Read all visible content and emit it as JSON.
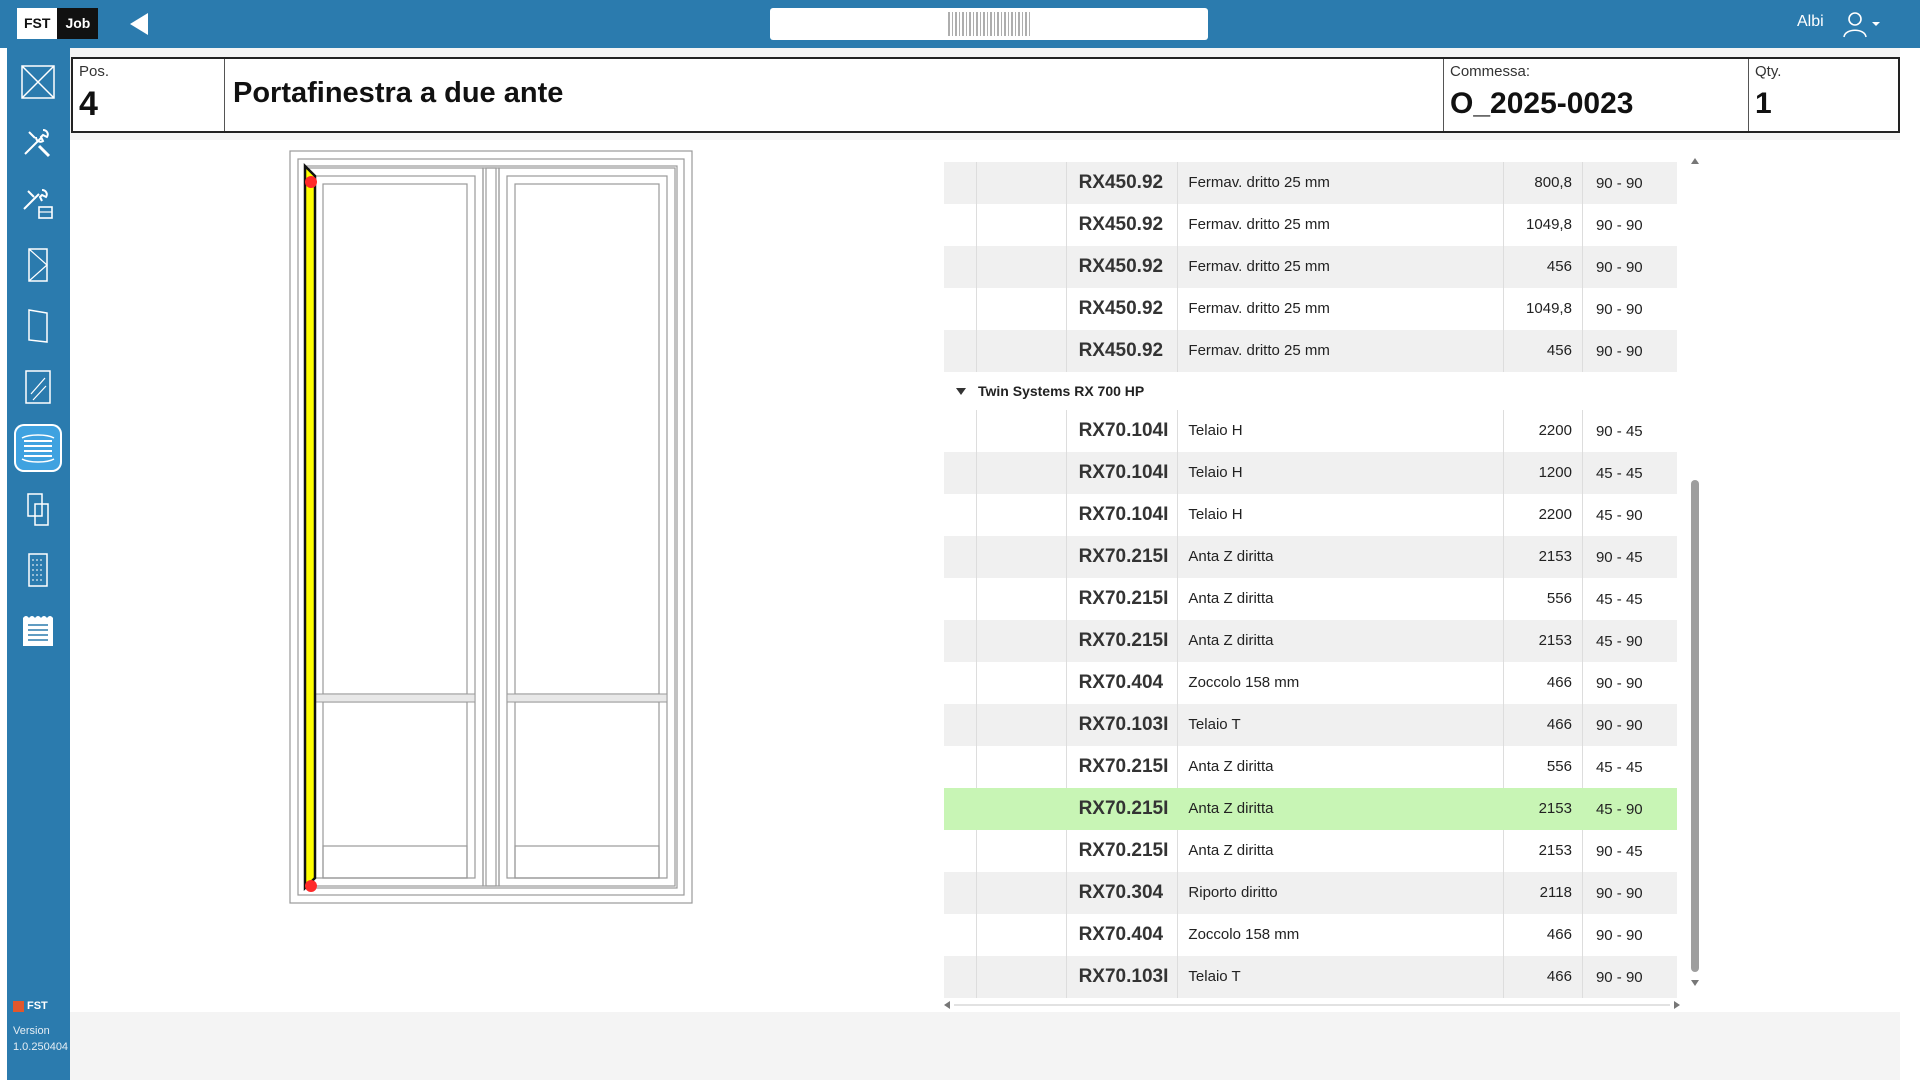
{
  "app": {
    "logo_left": "FST",
    "logo_right": "Job",
    "user": "Albi"
  },
  "search": {
    "placeholder": ""
  },
  "sidebar": {
    "brand": "FST",
    "version_label": "Version",
    "version": "1.0.250404",
    "items": [
      {
        "icon": "frame-cross-icon"
      },
      {
        "icon": "tools-icon"
      },
      {
        "icon": "tools-box-icon"
      },
      {
        "icon": "door-profile-icon"
      },
      {
        "icon": "sash-panel-icon"
      },
      {
        "icon": "glass-pane-icon"
      },
      {
        "icon": "profile-list-icon",
        "active": true
      },
      {
        "icon": "components-icon"
      },
      {
        "icon": "cut-list-icon"
      },
      {
        "icon": "report-list-icon"
      }
    ]
  },
  "header": {
    "pos_label": "Pos.",
    "pos_value": "4",
    "title": "Portafinestra a due ante",
    "order_label": "Commessa:",
    "order_value": "O_2025-0023",
    "qty_label": "Qty.",
    "qty_value": "1"
  },
  "table": {
    "rows_top": [
      {
        "code": "RX450.92",
        "desc": "Fermav. dritto 25 mm",
        "length": "800,8",
        "angles": "90 - 90"
      },
      {
        "code": "RX450.92",
        "desc": "Fermav. dritto 25 mm",
        "length": "1049,8",
        "angles": "90 - 90"
      },
      {
        "code": "RX450.92",
        "desc": "Fermav. dritto 25 mm",
        "length": "456",
        "angles": "90 - 90"
      },
      {
        "code": "RX450.92",
        "desc": "Fermav. dritto 25 mm",
        "length": "1049,8",
        "angles": "90 - 90"
      },
      {
        "code": "RX450.92",
        "desc": "Fermav. dritto 25 mm",
        "length": "456",
        "angles": "90 - 90"
      }
    ],
    "group": "Twin Systems RX 700 HP",
    "rows_group": [
      {
        "code": "RX70.104I",
        "desc": "Telaio H",
        "length": "2200",
        "angles": "90 - 45"
      },
      {
        "code": "RX70.104I",
        "desc": "Telaio H",
        "length": "1200",
        "angles": "45 - 45"
      },
      {
        "code": "RX70.104I",
        "desc": "Telaio H",
        "length": "2200",
        "angles": "45 - 90"
      },
      {
        "code": "RX70.215I",
        "desc": "Anta Z diritta",
        "length": "2153",
        "angles": "90 - 45"
      },
      {
        "code": "RX70.215I",
        "desc": "Anta Z diritta",
        "length": "556",
        "angles": "45 - 45"
      },
      {
        "code": "RX70.215I",
        "desc": "Anta Z diritta",
        "length": "2153",
        "angles": "45 - 90"
      },
      {
        "code": "RX70.404",
        "desc": "Zoccolo 158 mm",
        "length": "466",
        "angles": "90 - 90"
      },
      {
        "code": "RX70.103I",
        "desc": "Telaio T",
        "length": "466",
        "angles": "90 - 90"
      },
      {
        "code": "RX70.215I",
        "desc": "Anta Z diritta",
        "length": "556",
        "angles": "45 - 45"
      },
      {
        "code": "RX70.215I",
        "desc": "Anta Z diritta",
        "length": "2153",
        "angles": "45 - 90",
        "selected": true
      },
      {
        "code": "RX70.215I",
        "desc": "Anta Z diritta",
        "length": "2153",
        "angles": "90 - 45"
      },
      {
        "code": "RX70.304",
        "desc": "Riporto diritto",
        "length": "2118",
        "angles": "90 - 90"
      },
      {
        "code": "RX70.404",
        "desc": "Zoccolo 158 mm",
        "length": "466",
        "angles": "90 - 90"
      },
      {
        "code": "RX70.103I",
        "desc": "Telaio T",
        "length": "466",
        "angles": "90 - 90"
      }
    ]
  },
  "colors": {
    "brand": "#2b7bae",
    "selected_row": "#c8f5b5",
    "highlight_profile": "#ffff00",
    "marker": "#ff2a2a"
  }
}
